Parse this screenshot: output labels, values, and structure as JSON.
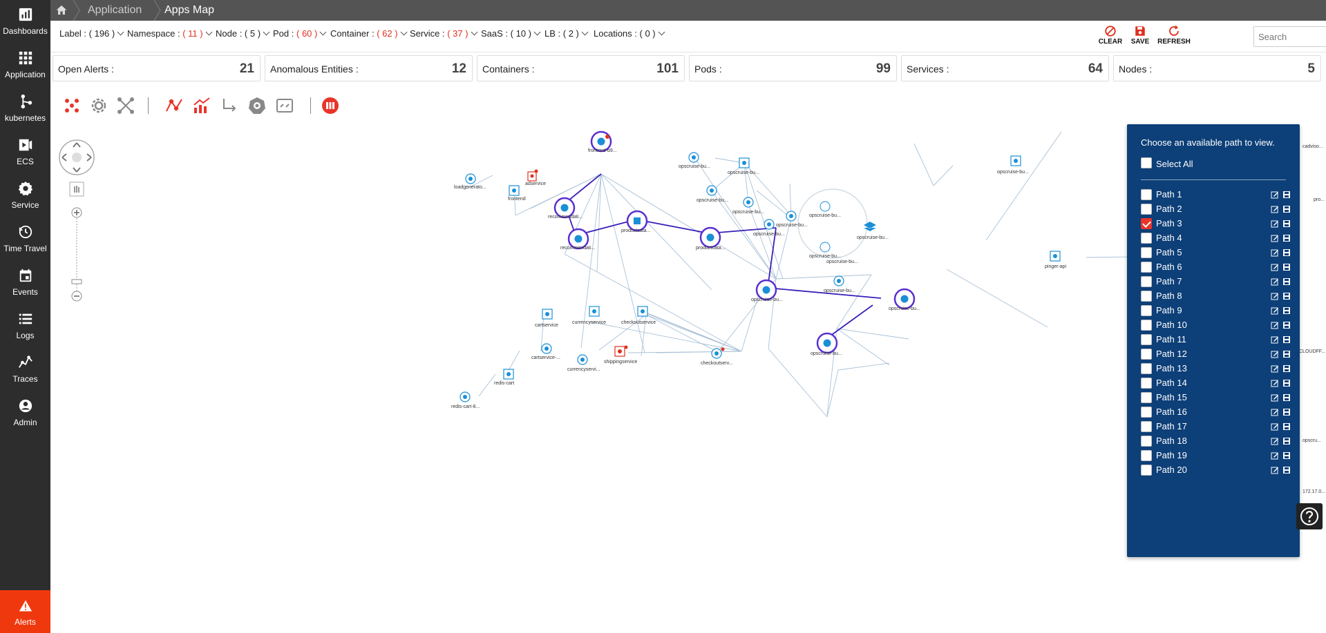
{
  "sidebar": {
    "items": [
      {
        "label": "Dashboards",
        "icon": "dashboard-icon"
      },
      {
        "label": "Application",
        "icon": "grid-icon"
      },
      {
        "label": "kubernetes",
        "icon": "share-icon"
      },
      {
        "label": "ECS",
        "icon": "ecs-icon"
      },
      {
        "label": "Service",
        "icon": "gear-icon"
      },
      {
        "label": "Time Travel",
        "icon": "time-travel-icon"
      },
      {
        "label": "Events",
        "icon": "calendar-icon"
      },
      {
        "label": "Logs",
        "icon": "list-icon"
      },
      {
        "label": "Traces",
        "icon": "traces-icon"
      },
      {
        "label": "Admin",
        "icon": "user-icon"
      }
    ],
    "alerts": {
      "label": "Alerts",
      "icon": "warning-icon",
      "color": "#f0380e"
    }
  },
  "breadcrumb": {
    "home_icon": "home-icon",
    "items": [
      "Application",
      "Apps Map"
    ]
  },
  "filters": [
    {
      "name": "Label",
      "count": "196",
      "highlight": false
    },
    {
      "name": "Namespace",
      "count": "11",
      "highlight": true
    },
    {
      "name": "Node",
      "count": "5",
      "highlight": false
    },
    {
      "name": "Pod",
      "count": "60",
      "highlight": true
    },
    {
      "name": "Container",
      "count": "62",
      "highlight": true
    },
    {
      "name": "Service",
      "count": "37",
      "highlight": true
    },
    {
      "name": "SaaS",
      "count": "10",
      "highlight": false
    },
    {
      "name": "LB",
      "count": "2",
      "highlight": false
    },
    {
      "name": "Locations",
      "count": "0",
      "highlight": false
    }
  ],
  "actions": {
    "clear": "CLEAR",
    "save": "SAVE",
    "refresh": "REFRESH",
    "accent": "#e0301e"
  },
  "search": {
    "placeholder": "Search",
    "value": ""
  },
  "stats": [
    {
      "label": "Open Alerts :",
      "value": "21"
    },
    {
      "label": "Anomalous Entities :",
      "value": "12"
    },
    {
      "label": "Containers :",
      "value": "101"
    },
    {
      "label": "Pods :",
      "value": "99"
    },
    {
      "label": "Services :",
      "value": "64"
    },
    {
      "label": "Nodes :",
      "value": "5"
    }
  ],
  "toolbar": [
    "cluster-layout-icon",
    "gear-layout-icon",
    "expand-icon",
    "path-icon",
    "trend-chart-icon",
    "step-icon",
    "kubernetes-icon",
    "fit-screen-icon",
    "app-logo-icon"
  ],
  "graph": {
    "labels": [
      "frontend-b9...",
      "adservice",
      "loadgenerato...",
      "frontend",
      "recommendati...",
      "recommendati...",
      "productcata...",
      "productcata...",
      "cartservice",
      "currencyservice",
      "checkoutservice",
      "cartservice-...",
      "currencyservi...",
      "shippingservice",
      "checkoutserv...",
      "redis-cart",
      "redis-cart-8...",
      "opscruise-bu...",
      "opscruise-bu...",
      "opscruise-bu...",
      "opscruise-bu...",
      "opscruise-bu...",
      "opscruise-bu...",
      "opscruise-bu...",
      "opscruise-bu...",
      "opscruise-bu...",
      "opscruise-bu...",
      "opscruise-bu...",
      "opscruise-bu...",
      "opscruise-bu...",
      "opscruise-bu...",
      "opscruise-bu...",
      "pinger-api",
      "cadviso...",
      "pro...",
      "CLOUDFF...",
      "opscru...",
      "172.17.0..."
    ],
    "edge_color": "#a9c1d6",
    "path_color": "#3a1fb8",
    "node_color": "#1a8fd6"
  },
  "path_panel": {
    "title": "Choose an available path to view.",
    "select_all": "Select All",
    "paths": [
      {
        "label": "Path 1",
        "checked": false
      },
      {
        "label": "Path 2",
        "checked": false
      },
      {
        "label": "Path 3",
        "checked": true
      },
      {
        "label": "Path 4",
        "checked": false
      },
      {
        "label": "Path 5",
        "checked": false
      },
      {
        "label": "Path 6",
        "checked": false
      },
      {
        "label": "Path 7",
        "checked": false
      },
      {
        "label": "Path 8",
        "checked": false
      },
      {
        "label": "Path 9",
        "checked": false
      },
      {
        "label": "Path 10",
        "checked": false
      },
      {
        "label": "Path 11",
        "checked": false
      },
      {
        "label": "Path 12",
        "checked": false
      },
      {
        "label": "Path 13",
        "checked": false
      },
      {
        "label": "Path 14",
        "checked": false
      },
      {
        "label": "Path 15",
        "checked": false
      },
      {
        "label": "Path 16",
        "checked": false
      },
      {
        "label": "Path 17",
        "checked": false
      },
      {
        "label": "Path 18",
        "checked": false
      },
      {
        "label": "Path 19",
        "checked": false
      },
      {
        "label": "Path 20",
        "checked": false
      }
    ],
    "background": "#0d3f78"
  },
  "help": {
    "icon": "help-icon"
  }
}
